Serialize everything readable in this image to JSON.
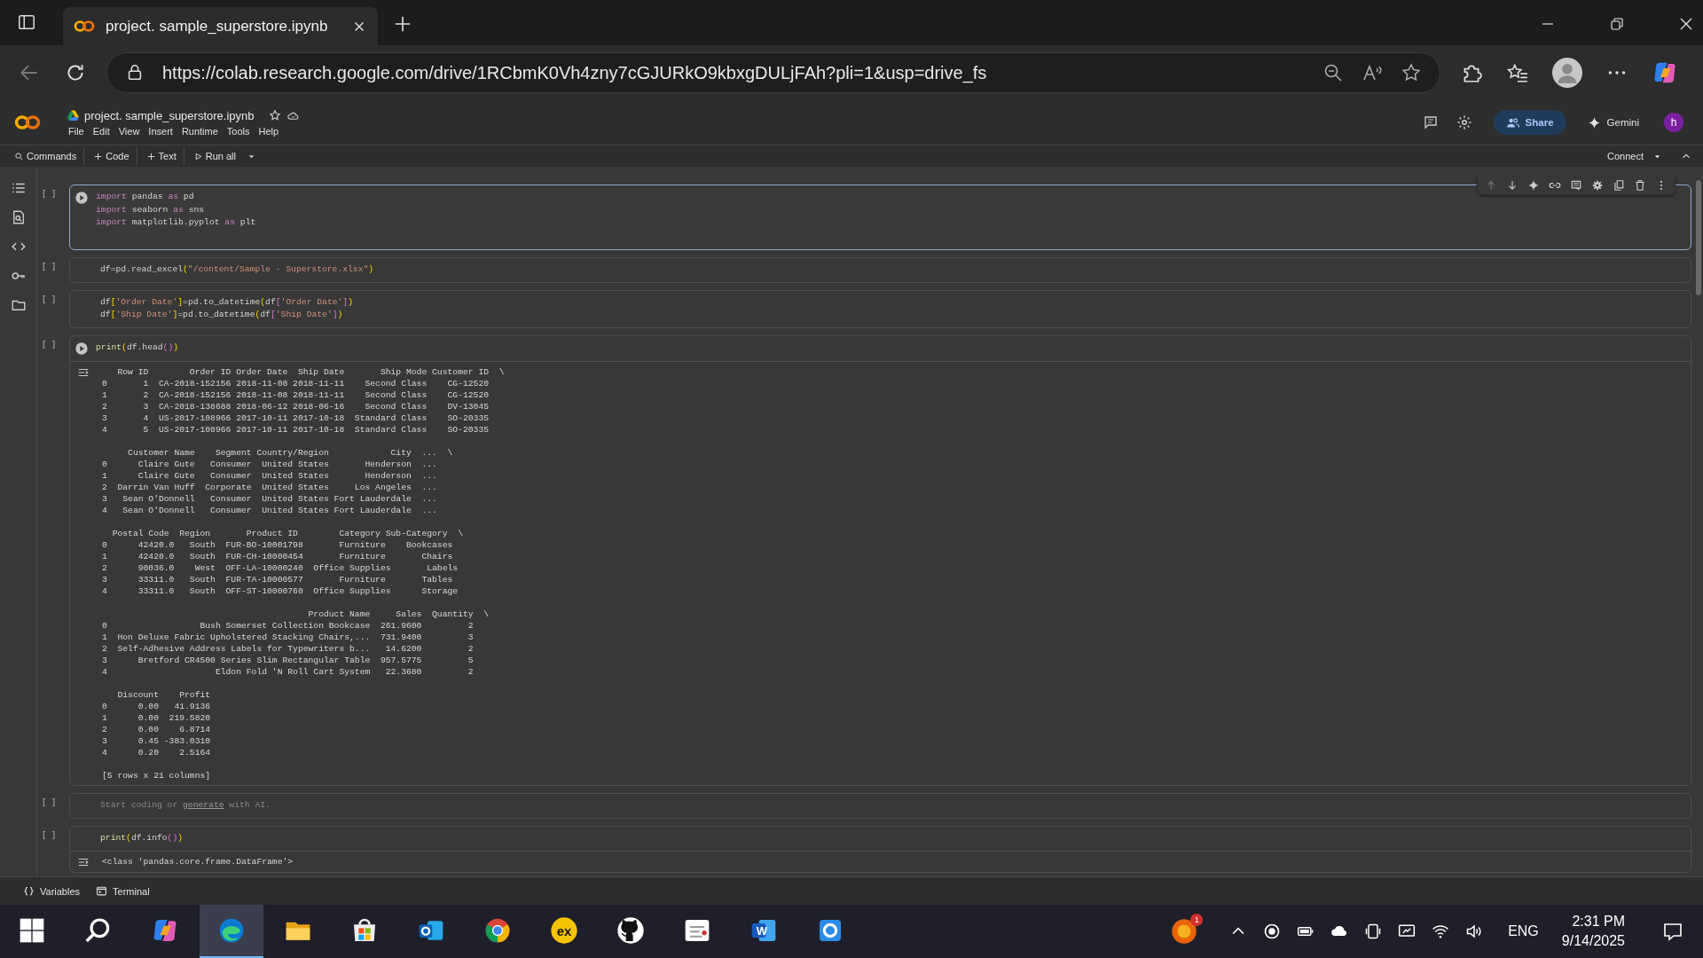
{
  "browser": {
    "tab_title": "project. sample_superstore.ipynb",
    "url": "https://colab.research.google.com/drive/1RCbmK0Vh4zny7cGJURkO9kbxgDULjFAh?pli=1&usp=drive_fs"
  },
  "notebook": {
    "title": "project. sample_superstore.ipynb",
    "menu": [
      "File",
      "Edit",
      "View",
      "Insert",
      "Runtime",
      "Tools",
      "Help"
    ],
    "share": "Share",
    "gemini": "Gemini",
    "avatar": "h"
  },
  "toolbar": {
    "items": [
      "Commands",
      "Code",
      "Text",
      "Run all"
    ],
    "connect": "Connect"
  },
  "cells": [
    {
      "kind": "code",
      "bracket": "[ ]",
      "focused": true,
      "run_visible": true,
      "code": [
        [
          {
            "t": "import",
            "kind": "kw"
          },
          {
            "t": " pandas ",
            "kind": "plain"
          },
          {
            "t": "as",
            "kind": "kw"
          },
          {
            "t": " pd",
            "kind": "plain"
          }
        ],
        [
          {
            "t": "import",
            "kind": "kw"
          },
          {
            "t": " seaborn ",
            "kind": "plain"
          },
          {
            "t": "as",
            "kind": "kw"
          },
          {
            "t": " sns",
            "kind": "plain"
          }
        ],
        [
          {
            "t": "import",
            "kind": "kw"
          },
          {
            "t": " matplotlib.pyplot ",
            "kind": "plain"
          },
          {
            "t": "as",
            "kind": "kw"
          },
          {
            "t": " plt",
            "kind": "plain"
          }
        ]
      ]
    },
    {
      "kind": "code",
      "bracket": "[ ]",
      "focused": false,
      "run_visible": false,
      "code": [
        [
          {
            "t": "df=pd.read_excel",
            "kind": "plain"
          },
          {
            "t": "(",
            "kind": "br1"
          },
          {
            "t": "\"/content/Sample - Superstore.xlsx\"",
            "kind": "str"
          },
          {
            "t": ")",
            "kind": "br1"
          }
        ]
      ]
    },
    {
      "kind": "code",
      "bracket": "[ ]",
      "focused": false,
      "run_visible": false,
      "code": [
        [
          {
            "t": "df",
            "kind": "plain"
          },
          {
            "t": "[",
            "kind": "br1"
          },
          {
            "t": "'Order Date'",
            "kind": "str"
          },
          {
            "t": "]",
            "kind": "br1"
          },
          {
            "t": "=pd.to_datetime",
            "kind": "plain"
          },
          {
            "t": "(",
            "kind": "br1"
          },
          {
            "t": "df",
            "kind": "plain"
          },
          {
            "t": "[",
            "kind": "br2"
          },
          {
            "t": "'Order Date'",
            "kind": "str"
          },
          {
            "t": "]",
            "kind": "br2"
          },
          {
            "t": ")",
            "kind": "br1"
          }
        ],
        [
          {
            "t": "df",
            "kind": "plain"
          },
          {
            "t": "[",
            "kind": "br1"
          },
          {
            "t": "'Ship Date'",
            "kind": "str"
          },
          {
            "t": "]",
            "kind": "br1"
          },
          {
            "t": "=pd.to_datetime",
            "kind": "plain"
          },
          {
            "t": "(",
            "kind": "br1"
          },
          {
            "t": "df",
            "kind": "plain"
          },
          {
            "t": "[",
            "kind": "br2"
          },
          {
            "t": "'Ship Date'",
            "kind": "str"
          },
          {
            "t": "]",
            "kind": "br2"
          },
          {
            "t": ")",
            "kind": "br1"
          }
        ]
      ]
    },
    {
      "kind": "code",
      "bracket": "[ ]",
      "focused": false,
      "run_visible": true,
      "code": [
        [
          {
            "t": "print",
            "kind": "fn"
          },
          {
            "t": "(",
            "kind": "br1"
          },
          {
            "t": "df.head",
            "kind": "plain"
          },
          {
            "t": "()",
            "kind": "br2"
          },
          {
            "t": ")",
            "kind": "br1"
          }
        ]
      ],
      "output": [
        [
          "   Row ID        Order ID Order Date  Ship Date       Ship Mode Customer ID  \\",
          "0       1  CA-2018-152156 2018-11-08 2018-11-11    Second Class    CG-12520",
          "1       2  CA-2018-152156 2018-11-08 2018-11-11    Second Class    CG-12520",
          "2       3  CA-2018-138688 2018-06-12 2018-06-16    Second Class    DV-13045",
          "3       4  US-2017-108966 2017-10-11 2017-10-18  Standard Class    SO-20335",
          "4       5  US-2017-108966 2017-10-11 2017-10-18  Standard Class    SO-20335"
        ],
        [
          "     Customer Name    Segment Country/Region            City  ...  \\",
          "0      Claire Gute   Consumer  United States       Henderson  ...",
          "1      Claire Gute   Consumer  United States       Henderson  ...",
          "2  Darrin Van Huff  Corporate  United States     Los Angeles  ...",
          "3   Sean O'Donnell   Consumer  United States Fort Lauderdale  ...",
          "4   Sean O'Donnell   Consumer  United States Fort Lauderdale  ..."
        ],
        [
          "  Postal Code  Region       Product ID        Category Sub-Category  \\",
          "0      42420.0   South  FUR-BO-10001798       Furniture    Bookcases",
          "1      42420.0   South  FUR-CH-10000454       Furniture       Chairs",
          "2      90036.0    West  OFF-LA-10000240  Office Supplies       Labels",
          "3      33311.0   South  FUR-TA-10000577       Furniture       Tables",
          "4      33311.0   South  OFF-ST-10000760  Office Supplies      Storage"
        ],
        [
          "                                        Product Name     Sales  Quantity  \\",
          "0                  Bush Somerset Collection Bookcase  261.9600         2",
          "1  Hon Deluxe Fabric Upholstered Stacking Chairs,...  731.9400         3",
          "2  Self-Adhesive Address Labels for Typewriters b...   14.6200         2",
          "3      Bretford CR4500 Series Slim Rectangular Table  957.5775         5",
          "4                     Eldon Fold 'N Roll Cart System   22.3680         2"
        ],
        [
          "   Discount    Profit",
          "0      0.00   41.9136",
          "1      0.00  219.5820",
          "2      0.00    6.8714",
          "3      0.45 -383.0310",
          "4      0.20    2.5164"
        ],
        [
          "[5 rows x 21 columns]"
        ]
      ]
    },
    {
      "kind": "empty",
      "bracket": "[ ]",
      "focused": false,
      "run_visible": false,
      "placeholder": {
        "before": "Start coding or ",
        "link": "generate",
        "after": " with AI."
      }
    },
    {
      "kind": "code",
      "bracket": "[ ]",
      "focused": false,
      "run_visible": false,
      "code": [
        [
          {
            "t": "print",
            "kind": "fn"
          },
          {
            "t": "(",
            "kind": "br1"
          },
          {
            "t": "df.info",
            "kind": "plain"
          },
          {
            "t": "()",
            "kind": "br2"
          },
          {
            "t": ")",
            "kind": "br1"
          }
        ]
      ],
      "output": [
        [
          "<class 'pandas.core.frame.DataFrame'>"
        ]
      ]
    }
  ],
  "bottom_bar": [
    "Variables",
    "Terminal"
  ],
  "taskbar": {
    "apps": [
      {
        "kind": "windows",
        "selected": false
      },
      {
        "kind": "search",
        "selected": false
      },
      {
        "kind": "copilot",
        "selected": false
      },
      {
        "kind": "edge",
        "selected": true
      },
      {
        "kind": "folder",
        "selected": false
      },
      {
        "kind": "store",
        "selected": false
      },
      {
        "kind": "outlook",
        "selected": false
      },
      {
        "kind": "chrome",
        "selected": false
      },
      {
        "kind": "ex",
        "selected": false,
        "label": "ex"
      },
      {
        "kind": "github",
        "selected": false
      },
      {
        "kind": "itida",
        "selected": false
      },
      {
        "kind": "word",
        "selected": false,
        "label": "W"
      },
      {
        "kind": "bluecam",
        "selected": false
      }
    ],
    "notification_badge": "1",
    "language": "ENG",
    "time": "2:31 PM",
    "date": "9/14/2025"
  }
}
